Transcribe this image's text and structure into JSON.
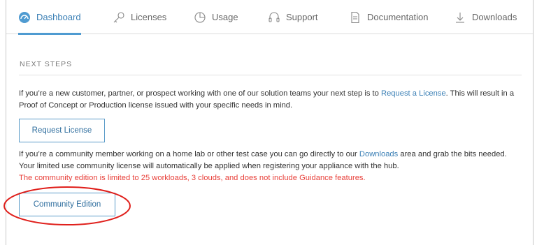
{
  "nav": {
    "tabs": [
      {
        "label": "Dashboard",
        "icon": "dashboard-icon",
        "active": true
      },
      {
        "label": "Licenses",
        "icon": "key-icon",
        "active": false
      },
      {
        "label": "Usage",
        "icon": "pie-chart-icon",
        "active": false
      },
      {
        "label": "Support",
        "icon": "headset-icon",
        "active": false
      },
      {
        "label": "Documentation",
        "icon": "document-icon",
        "active": false
      },
      {
        "label": "Downloads",
        "icon": "download-icon",
        "active": false
      }
    ]
  },
  "main": {
    "section_title": "NEXT STEPS",
    "para1": {
      "text_before": "If you’re a new customer, partner, or prospect working with one of our solution teams your next step is to ",
      "link": "Request a License",
      "text_after": ". This will result in a Proof of Concept or Production license issued with your specific needs in mind."
    },
    "request_button": "Request License",
    "para2": {
      "text_before": "If you’re a community member working on a home lab or other test case you can go directly to our ",
      "link": "Downloads",
      "text_after": " area and grab the bits needed. Your limited use community license will automatically be applied when registering your appliance with the hub.",
      "warning": "The community edition is limited to 25 workloads, 3 clouds, and does not include Guidance features."
    },
    "community_button": "Community Edition"
  },
  "colors": {
    "accent": "#4f9bd1",
    "link": "#3a7fb5",
    "warning": "#e8403a",
    "annotation": "#e0201c"
  }
}
